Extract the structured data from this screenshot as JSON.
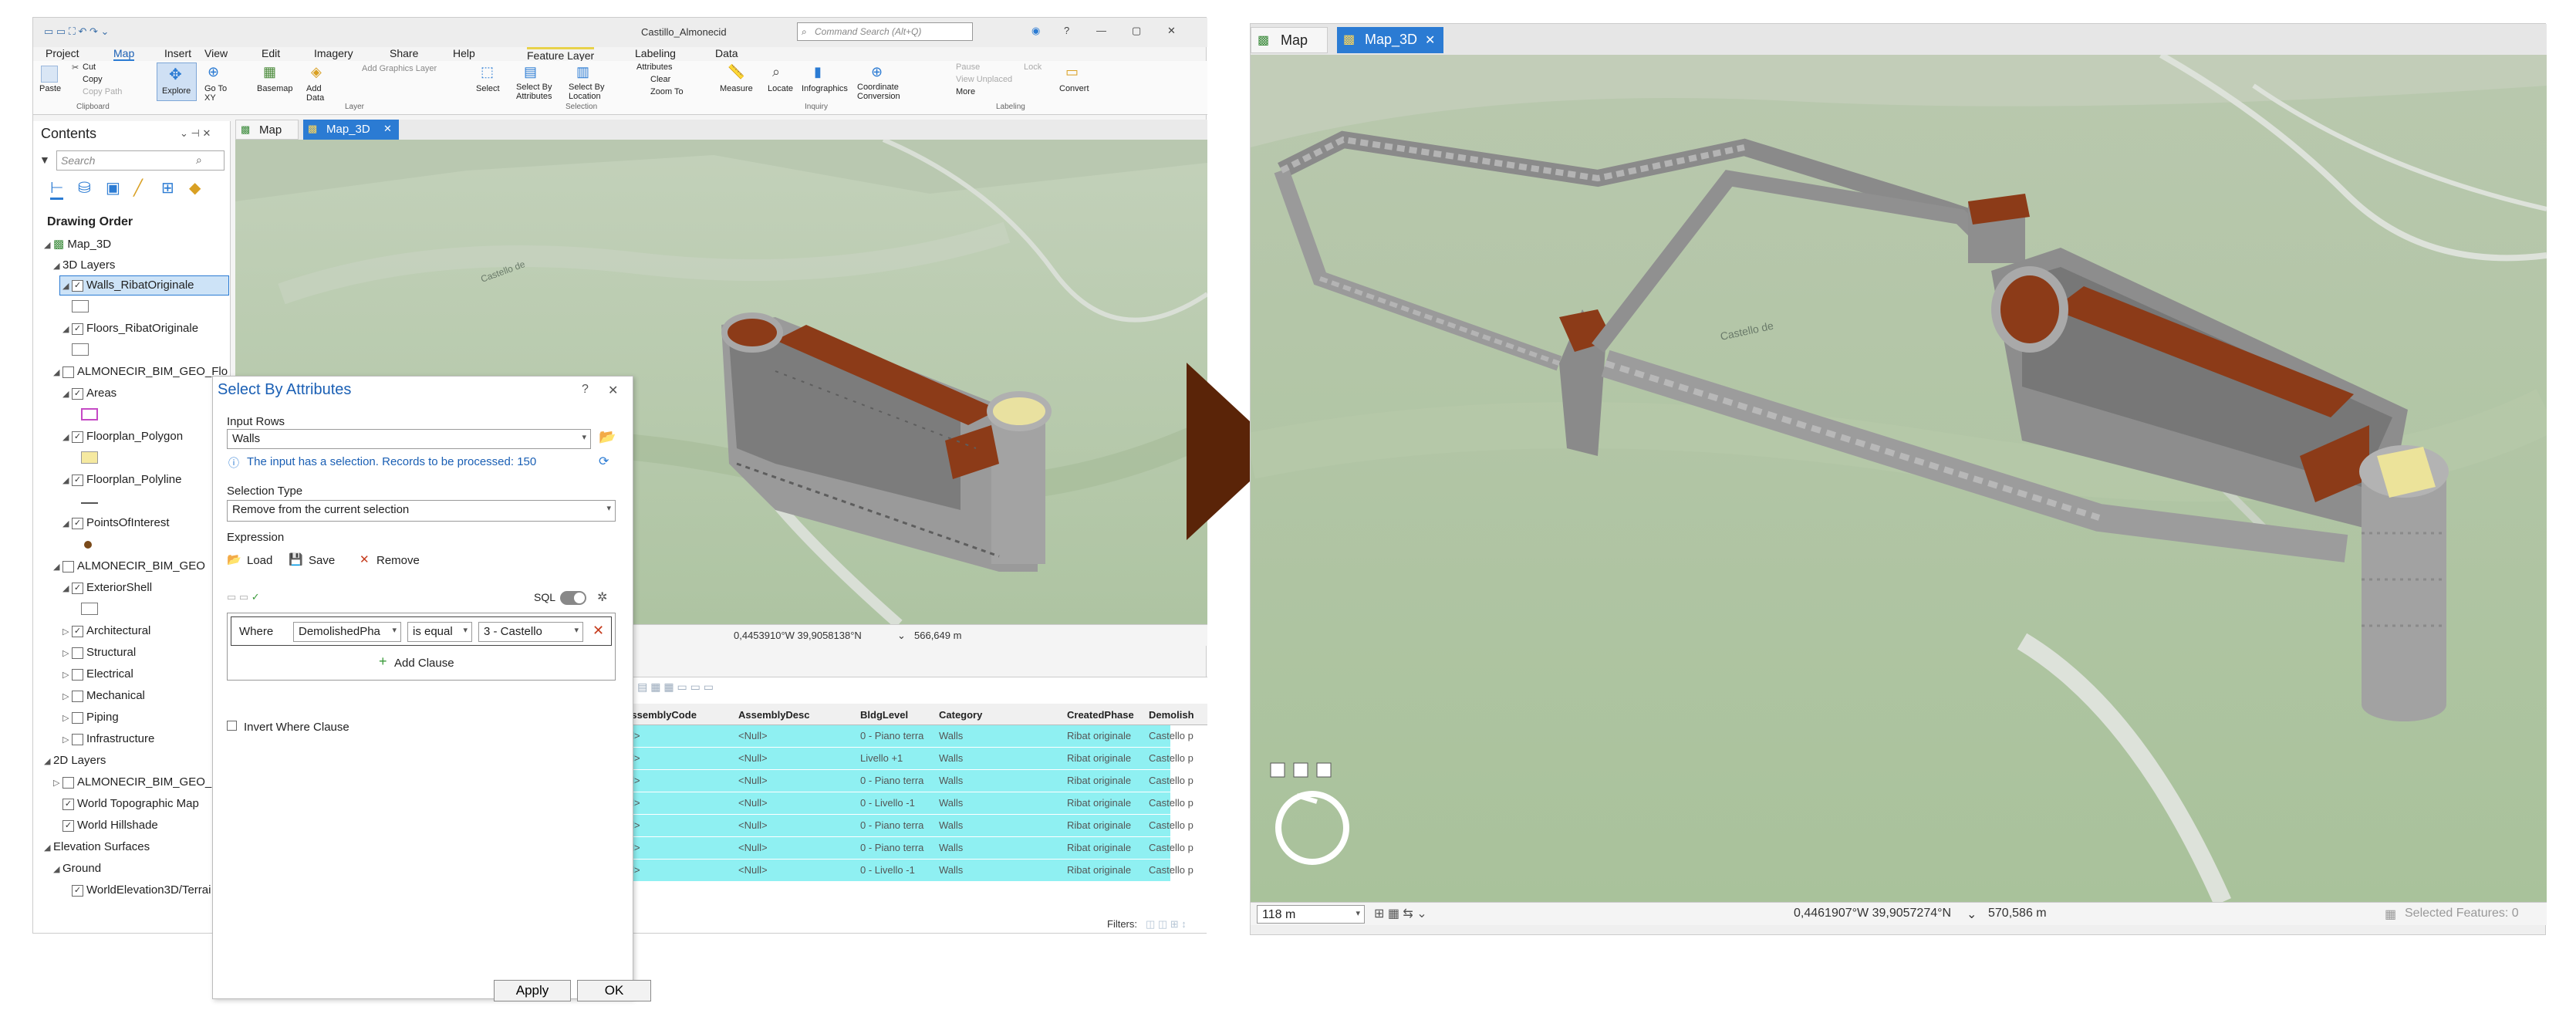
{
  "left": {
    "app": {
      "project_title": "Castillo_Almonecid",
      "search_placeholder": "Command Search (Alt+Q)"
    },
    "ribbon": {
      "tabs": [
        "Project",
        "Map",
        "Insert",
        "View",
        "Edit",
        "Imagery",
        "Share",
        "Help",
        "Feature Layer",
        "Labeling",
        "Data"
      ],
      "clipboard": {
        "paste": "Paste",
        "cut": "Cut",
        "copy": "Copy",
        "copy_path": "Copy Path",
        "group": "Clipboard"
      },
      "navigate": {
        "explore": "Explore",
        "goto": "Go To XY"
      },
      "layer": {
        "basemap": "Basemap",
        "add_data": "Add Data",
        "add_graphics": "Add Graphics Layer",
        "group": "Layer"
      },
      "selection": {
        "select": "Select",
        "by_attr": "Select By Attributes",
        "by_loc": "Select By Location",
        "attributes": "Attributes",
        "clear": "Clear",
        "zoom_to": "Zoom To",
        "group": "Selection"
      },
      "inquiry": {
        "measure": "Measure",
        "locate": "Locate",
        "infographics": "Infographics",
        "coord": "Coordinate Conversion",
        "group": "Inquiry"
      },
      "labeling": {
        "pause": "Pause",
        "lock": "Lock",
        "view_unplaced": "View Unplaced",
        "more": "More",
        "convert": "Convert",
        "group": "Labeling"
      }
    },
    "contents": {
      "title": "Contents",
      "search_placeholder": "Search",
      "drawing_order": "Drawing Order",
      "tree": [
        "Map_3D",
        "3D Layers",
        "Walls_RibatOriginale",
        "Floors_RibatOriginale",
        "ALMONECIR_BIM_GEO_Flo",
        "Areas",
        "Floorplan_Polygon",
        "Floorplan_Polyline",
        "PointsOfInterest",
        "ALMONECIR_BIM_GEO",
        "ExteriorShell",
        "Architectural",
        "Structural",
        "Electrical",
        "Mechanical",
        "Piping",
        "Infrastructure",
        "2D Layers",
        "ALMONECIR_BIM_GEO_Flo",
        "World Topographic Map",
        "World Hillshade",
        "Elevation Surfaces",
        "Ground",
        "WorldElevation3D/Terrai"
      ]
    },
    "map_tabs": [
      "Map",
      "Map_3D"
    ],
    "dialog": {
      "title": "Select By Attributes",
      "input_rows_label": "Input Rows",
      "input_rows_value": "Walls",
      "info": "The input has a selection. Records to be processed: 150",
      "selection_type_label": "Selection Type",
      "selection_type_value": "Remove from the current selection",
      "expression_label": "Expression",
      "load": "Load",
      "save": "Save",
      "remove": "Remove",
      "sql": "SQL",
      "where": "Where",
      "field": "DemolishedPha",
      "operator": "is equal",
      "value": "3 - Castello",
      "add_clause": "Add Clause",
      "invert": "Invert Where Clause",
      "apply": "Apply",
      "ok": "OK"
    },
    "status": {
      "coords": "0,4453910°W 39,9058138°N",
      "scale": "566,649 m"
    },
    "table": {
      "headers": [
        "AssemblyCode",
        "AssemblyDesc",
        "BldgLevel",
        "Category",
        "CreatedPhase",
        "Demolish"
      ],
      "rows": [
        [
          "ull>",
          "<Null>",
          "0 - Piano terra",
          "Walls",
          "Ribat originale",
          "Castello p"
        ],
        [
          "ull>",
          "<Null>",
          "Livello +1",
          "Walls",
          "Ribat originale",
          "Castello p"
        ],
        [
          "ull>",
          "<Null>",
          "0 - Piano terra",
          "Walls",
          "Ribat originale",
          "Castello p"
        ],
        [
          "ull>",
          "<Null>",
          "0 - Livello -1",
          "Walls",
          "Ribat originale",
          "Castello p"
        ],
        [
          "ull>",
          "<Null>",
          "0 - Piano terra",
          "Walls",
          "Ribat originale",
          "Castello p"
        ],
        [
          "ull>",
          "<Null>",
          "0 - Piano terra",
          "Walls",
          "Ribat originale",
          "Castello p"
        ],
        [
          "ull>",
          "<Null>",
          "0 - Livello -1",
          "Walls",
          "Ribat originale",
          "Castello p"
        ]
      ],
      "filters": "Filters:"
    }
  },
  "right": {
    "tabs": [
      "Map",
      "Map_3D"
    ],
    "scale": "118 m",
    "coords": "0,4461907°W 39,9057274°N",
    "elev": "570,586 m",
    "selected": "Selected Features: 0",
    "map_label": "Castello de"
  },
  "colors": {
    "accent": "#2b7bd3",
    "arrow": "#5a2408",
    "terrain": "#b3c8a6",
    "roof": "#8a3a16",
    "selection": "#8ff0f2"
  }
}
